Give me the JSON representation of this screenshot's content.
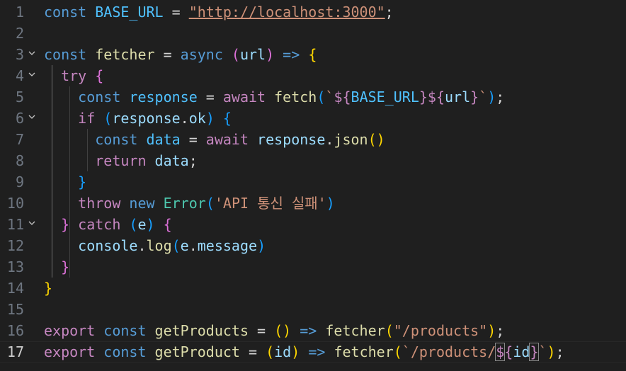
{
  "editor": {
    "language": "javascript",
    "active_line": 17,
    "line_numbers": [
      "1",
      "2",
      "3",
      "4",
      "5",
      "6",
      "7",
      "8",
      "9",
      "10",
      "11",
      "12",
      "13",
      "14",
      "15",
      "16",
      "17"
    ],
    "fold_icon": "chevron-down-icon",
    "foldable_lines": [
      3,
      4,
      6,
      11
    ],
    "lines": [
      [
        [
          "kw",
          "const "
        ],
        [
          "cst",
          "BASE_URL"
        ],
        [
          "op",
          " = "
        ],
        [
          "str u",
          "\"http://localhost:3000\""
        ],
        [
          "op",
          ";"
        ]
      ],
      [],
      [
        [
          "kw",
          "const "
        ],
        [
          "fn",
          "fetcher"
        ],
        [
          "op",
          " = "
        ],
        [
          "kw",
          "async "
        ],
        [
          "b2",
          "("
        ],
        [
          "var",
          "url"
        ],
        [
          "b2",
          ")"
        ],
        [
          "kw",
          " => "
        ],
        [
          "b1",
          "{"
        ]
      ],
      [
        [
          "ctl",
          "  try "
        ],
        [
          "b2",
          "{"
        ]
      ],
      [
        [
          "kw",
          "    const "
        ],
        [
          "cst",
          "response"
        ],
        [
          "op",
          " = "
        ],
        [
          "ctl",
          "await "
        ],
        [
          "fn",
          "fetch"
        ],
        [
          "b3",
          "("
        ],
        [
          "str",
          "`"
        ],
        [
          "ctl",
          "${"
        ],
        [
          "cst",
          "BASE_URL"
        ],
        [
          "ctl",
          "}${"
        ],
        [
          "var",
          "url"
        ],
        [
          "ctl",
          "}"
        ],
        [
          "str",
          "`"
        ],
        [
          "b3",
          ")"
        ],
        [
          "op",
          ";"
        ]
      ],
      [
        [
          "ctl",
          "    if "
        ],
        [
          "b3",
          "("
        ],
        [
          "var",
          "response"
        ],
        [
          "op",
          "."
        ],
        [
          "var",
          "ok"
        ],
        [
          "b3",
          ")"
        ],
        [
          "op",
          " "
        ],
        [
          "b3",
          "{"
        ]
      ],
      [
        [
          "kw",
          "      const "
        ],
        [
          "cst",
          "data"
        ],
        [
          "op",
          " = "
        ],
        [
          "ctl",
          "await "
        ],
        [
          "var",
          "response"
        ],
        [
          "op",
          "."
        ],
        [
          "fn",
          "json"
        ],
        [
          "b1",
          "()"
        ]
      ],
      [
        [
          "ctl",
          "      return "
        ],
        [
          "var",
          "data"
        ],
        [
          "op",
          ";"
        ]
      ],
      [
        [
          "b3",
          "    }"
        ]
      ],
      [
        [
          "ctl",
          "    throw "
        ],
        [
          "kw",
          "new "
        ],
        [
          "cls",
          "Error"
        ],
        [
          "b3",
          "("
        ],
        [
          "str",
          "'API 통신 실패'"
        ],
        [
          "b3",
          ")"
        ]
      ],
      [
        [
          "b2",
          "  }"
        ],
        [
          "ctl",
          " catch "
        ],
        [
          "b3",
          "("
        ],
        [
          "var",
          "e"
        ],
        [
          "b3",
          ")"
        ],
        [
          "op",
          " "
        ],
        [
          "b2",
          "{"
        ]
      ],
      [
        [
          "var",
          "    console"
        ],
        [
          "op",
          "."
        ],
        [
          "fn",
          "log"
        ],
        [
          "b3",
          "("
        ],
        [
          "var",
          "e"
        ],
        [
          "op",
          "."
        ],
        [
          "var",
          "message"
        ],
        [
          "b3",
          ")"
        ]
      ],
      [
        [
          "b2",
          "  }"
        ]
      ],
      [
        [
          "b1",
          "}"
        ]
      ],
      [],
      [
        [
          "ctl",
          "export "
        ],
        [
          "kw",
          "const "
        ],
        [
          "fn",
          "getProducts"
        ],
        [
          "op",
          " = "
        ],
        [
          "b1",
          "()"
        ],
        [
          "kw",
          " => "
        ],
        [
          "fn",
          "fetcher"
        ],
        [
          "b1",
          "("
        ],
        [
          "str",
          "\"/products\""
        ],
        [
          "b1",
          ")"
        ],
        [
          "op",
          ";"
        ]
      ],
      [
        [
          "ctl",
          "export "
        ],
        [
          "kw",
          "const "
        ],
        [
          "fn",
          "getProduct"
        ],
        [
          "op",
          " = "
        ],
        [
          "b1",
          "("
        ],
        [
          "var",
          "id"
        ],
        [
          "b1",
          ")"
        ],
        [
          "kw",
          " => "
        ],
        [
          "fn",
          "fetcher"
        ],
        [
          "b1",
          "("
        ],
        [
          "str",
          "`/products/"
        ],
        [
          "ctl brm",
          "$"
        ],
        [
          "ctl",
          "{"
        ],
        [
          "var",
          "id"
        ],
        [
          "ctl brm",
          "}"
        ],
        [
          "str",
          "`"
        ],
        [
          "b1",
          ")"
        ],
        [
          "op",
          ";"
        ]
      ]
    ]
  }
}
